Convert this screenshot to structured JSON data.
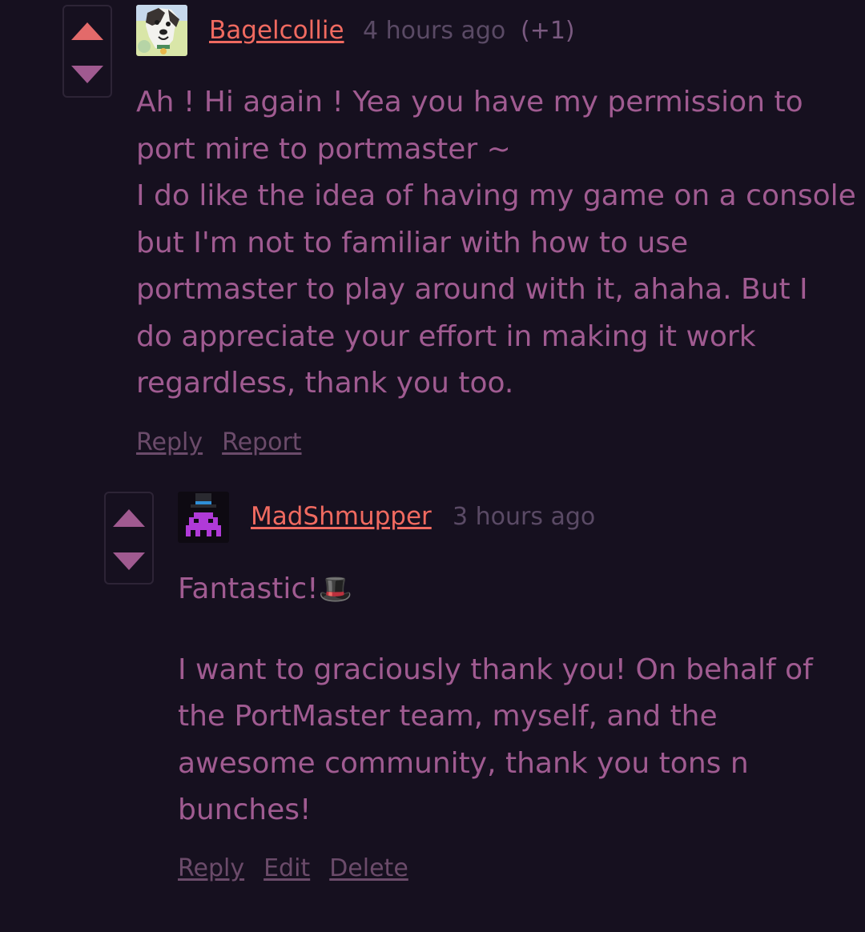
{
  "comment1": {
    "username": "Bagelcollie",
    "time": "4 hours ago",
    "score": "(+1)",
    "lines": [
      "Ah ! Hi again ! Yea you have my permission to",
      "port mire to portmaster ~",
      "I do like the idea of having my game on a console",
      "but I'm not to familiar with how to use",
      "portmaster to play around with it, ahaha. But I",
      "do appreciate your effort in making it work",
      "regardless, thank you too."
    ],
    "actions": [
      "Reply",
      "Report"
    ]
  },
  "comment2": {
    "username": "MadShmupper",
    "time": "3 hours ago",
    "first_line": "Fantastic!",
    "emoji": "🎩",
    "lines": [
      "I want to graciously thank you! On behalf of",
      "the PortMaster team, myself, and the",
      "awesome community, thank you tons n",
      "bunches!"
    ],
    "actions": [
      "Reply",
      "Edit",
      "Delete"
    ]
  },
  "colors": {
    "background": "#16101f",
    "username": "#f06a60",
    "body_text": "#a05b91",
    "upvote_active": "#e36a6a",
    "vote_inactive": "#a05a90"
  }
}
